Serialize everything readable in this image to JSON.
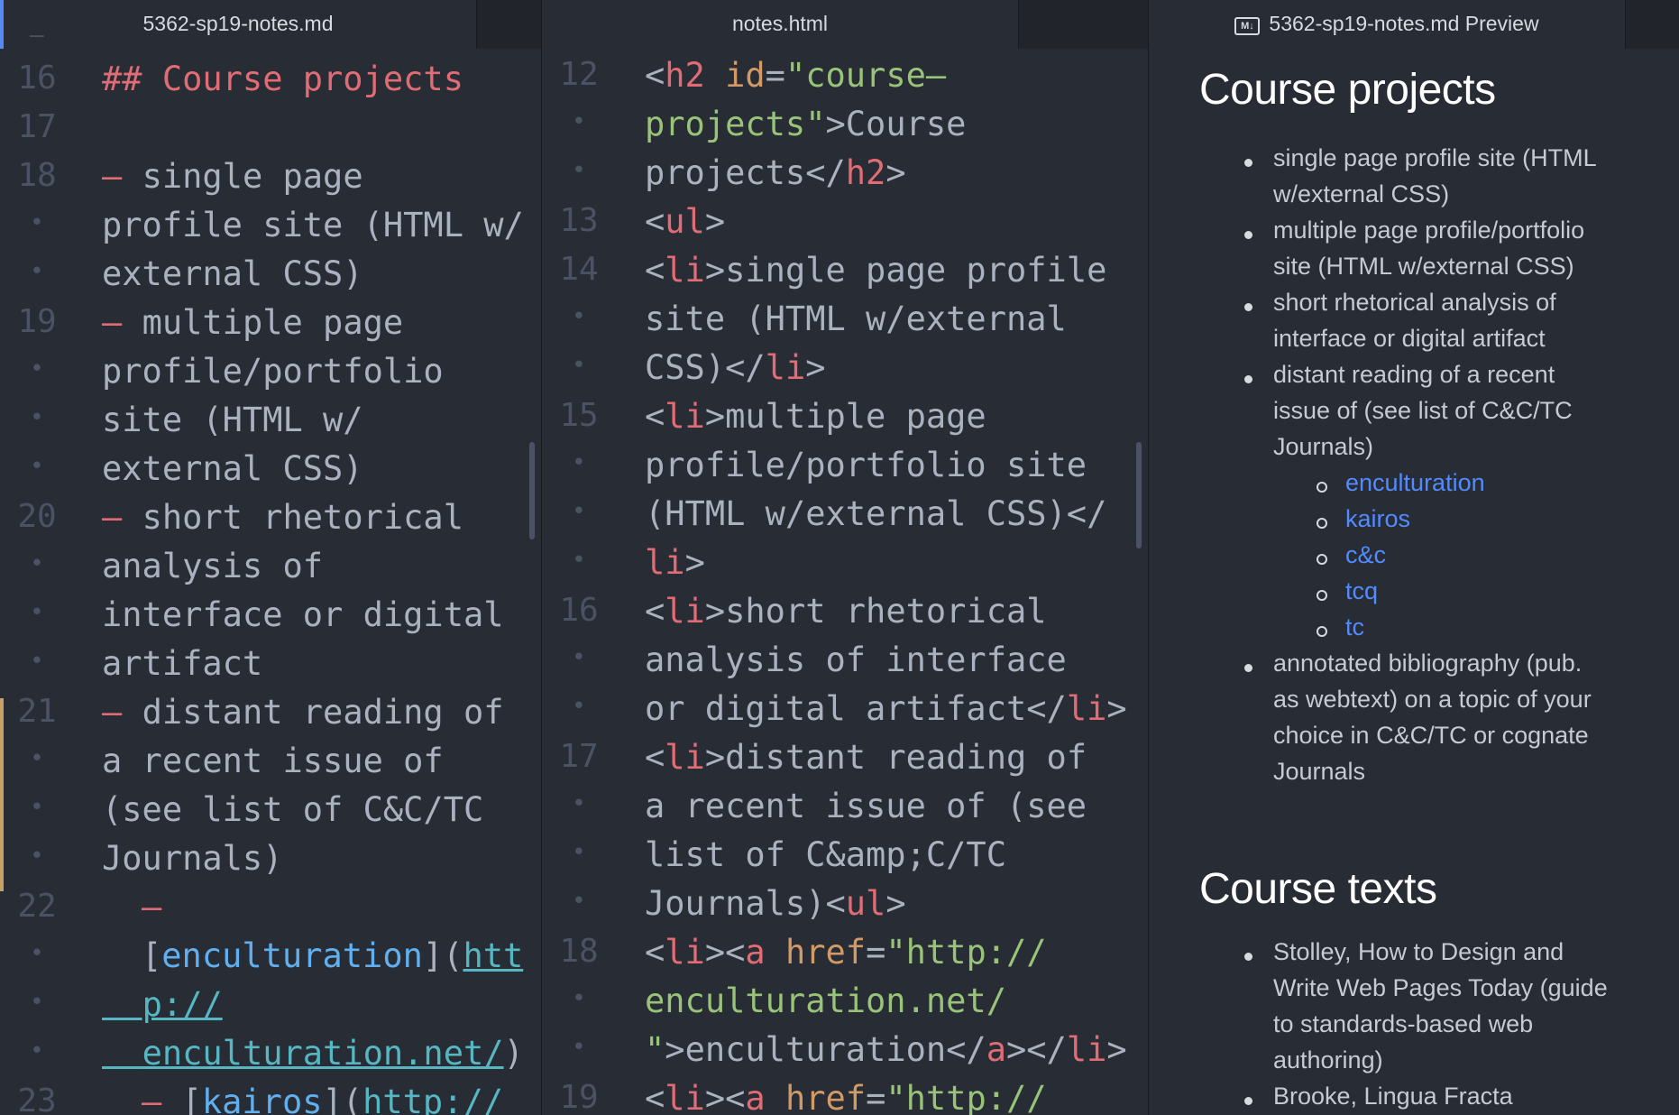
{
  "tabs": {
    "markdown": "5362-sp19-notes.md",
    "html": "notes.html",
    "preview": "5362-sp19-notes.md Preview",
    "preview_icon": "markdown-icon"
  },
  "md_editor": {
    "line_numbers": {
      "l16": "16",
      "l17": "17",
      "l18": "18",
      "l19": "19",
      "l20": "20",
      "l21": "21",
      "l22": "22",
      "l23": "23"
    },
    "heading_marker": "## ",
    "heading_text": "Course projects",
    "dash": "– ",
    "item1": [
      "single page",
      "profile site (HTML w/",
      "external CSS)"
    ],
    "item2": [
      "multiple page",
      "profile/portfolio",
      "site (HTML w/",
      "external CSS)"
    ],
    "item3": [
      "short rhetorical",
      "analysis of",
      "interface or digital",
      "artifact"
    ],
    "item4": [
      "distant reading of",
      "a recent issue of",
      "(see list of C&C/TC",
      "Journals)"
    ],
    "sub_dash": "–",
    "link_open": "[",
    "link_text": "enculturation",
    "link_mid": "](",
    "link_url_1": "htt",
    "link_url_2": "p://",
    "link_url_3": "enculturation.net/",
    "link_close": ")",
    "next_dash": "– ",
    "next_link_open": "[",
    "next_link_text": "kairos",
    "next_link_mid": "](",
    "next_link_url": "http://"
  },
  "html_editor": {
    "line_numbers": {
      "l12": "12",
      "l13": "13",
      "l14": "14",
      "l15": "15",
      "l16": "16",
      "l17": "17",
      "l18": "18",
      "l19": "19"
    },
    "h2_open_lt": "<",
    "h2_tag": "h2",
    "h2_attr": " id",
    "h2_eq": "=",
    "h2_val_1": "\"course–",
    "h2_val_2": "projects\"",
    "h2_gt": ">",
    "h2_text": "Course",
    "h2_text_2": "projects",
    "h2_close_lt": "</",
    "h2_close_gt": ">",
    "ul": "ul",
    "li": "li",
    "li1_text": [
      "single page profile",
      "site (HTML w/external",
      "CSS)"
    ],
    "li2_text": [
      "multiple page",
      "profile/portfolio site",
      "(HTML w/external CSS)</"
    ],
    "li3_text": [
      "short rhetorical",
      "analysis of interface",
      "or digital artifact"
    ],
    "li4_text": [
      "distant reading of",
      "a recent issue of (see",
      "list of C&amp;C/TC",
      "Journals)"
    ],
    "a_tag": "a",
    "href_attr": " href",
    "href_val_1": "\"http://",
    "href_val_2": "enculturation.net/",
    "href_val_3": "\"",
    "a_text": "enculturation",
    "li_close_end": "</",
    "gt": ">",
    "lt": "<"
  },
  "preview": {
    "h_projects": "Course projects",
    "projects": [
      [
        "single page profile site (HTML",
        "w/external CSS)"
      ],
      [
        "multiple page profile/portfolio",
        "site (HTML w/external CSS)"
      ],
      [
        "short rhetorical analysis of",
        "interface or digital artifact"
      ],
      [
        "distant reading of a recent",
        "issue of (see list of C&C/TC",
        "Journals)"
      ],
      [
        "annotated bibliography (pub.",
        "as webtext) on a topic of your",
        "choice in C&C/TC or cognate",
        "Journals"
      ]
    ],
    "journals": [
      "enculturation",
      "kairos",
      "c&c",
      "tcq",
      "tc"
    ],
    "h_texts": "Course texts",
    "texts": [
      [
        "Stolley, How to Design and",
        "Write Web Pages Today (guide",
        "to standards-based web",
        "authoring)"
      ],
      [
        "Brooke, Lingua Fracta"
      ]
    ]
  }
}
